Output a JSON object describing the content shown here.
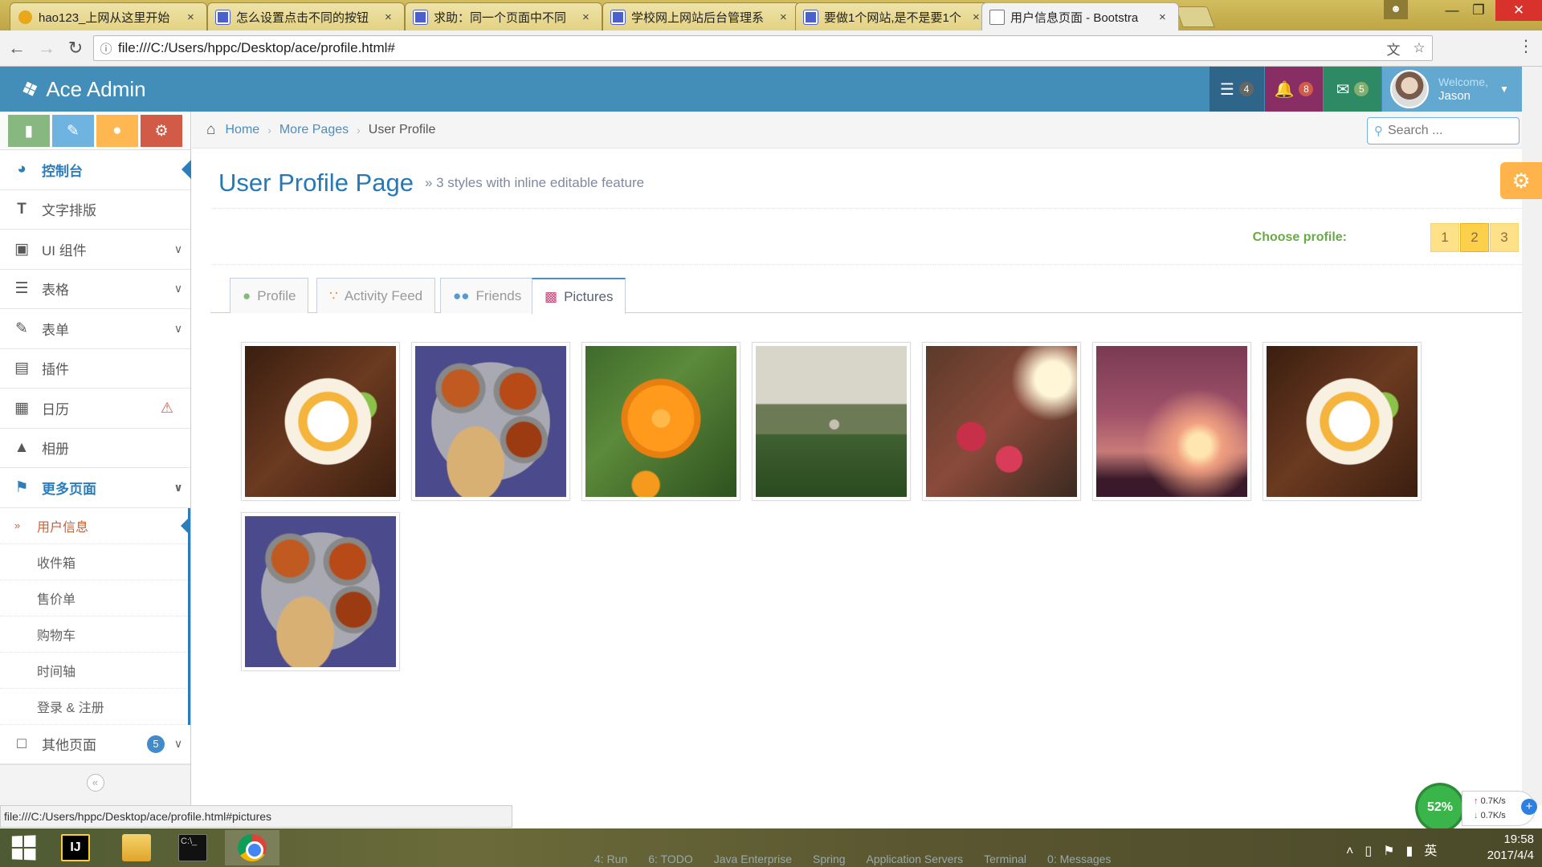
{
  "browser": {
    "tabs": [
      {
        "title": "hao123_上网从这里开始",
        "icon": "hao123-icon",
        "active": false
      },
      {
        "title": "怎么设置点击不同的按钮",
        "icon": "paw-icon",
        "active": false
      },
      {
        "title": "求助：同一个页面中不同",
        "icon": "paw-icon",
        "active": false
      },
      {
        "title": "学校网上网站后台管理系",
        "icon": "paw-icon",
        "active": false
      },
      {
        "title": "要做1个网站,是不是要1个",
        "icon": "paw-icon",
        "active": false
      },
      {
        "title": "用户信息页面 - Bootstra",
        "icon": "page-icon",
        "active": true
      }
    ],
    "tab_close": "×",
    "url": "file:///C:/Users/hppc/Desktop/ace/profile.html#",
    "status_url": "file:///C:/Users/hppc/Desktop/ace/profile.html#pictures"
  },
  "navbar": {
    "brand": "Ace Admin",
    "tasks_count": "4",
    "notifications_count": "8",
    "messages_count": "5",
    "welcome": "Welcome,",
    "username": "Jason"
  },
  "sidebar": {
    "items": [
      {
        "label": "控制台",
        "icon": "tachometer-icon"
      },
      {
        "label": "文字排版",
        "icon": "text-icon"
      },
      {
        "label": "UI 组件",
        "icon": "desktop-icon"
      },
      {
        "label": "表格",
        "icon": "list-icon"
      },
      {
        "label": "表单",
        "icon": "edit-icon"
      },
      {
        "label": "插件",
        "icon": "list-alt-icon"
      },
      {
        "label": "日历",
        "icon": "calendar-icon"
      },
      {
        "label": "相册",
        "icon": "picture-icon"
      },
      {
        "label": "更多页面",
        "icon": "tag-icon"
      },
      {
        "label": "其他页面",
        "icon": "file-icon"
      }
    ],
    "sub_items": [
      "用户信息",
      "收件箱",
      "售价单",
      "购物车",
      "时间轴",
      "登录 & 注册"
    ],
    "other_pages_badge": "5"
  },
  "breadcrumb": {
    "home": "Home",
    "more": "More Pages",
    "current": "User Profile"
  },
  "search": {
    "placeholder": "Search ..."
  },
  "page": {
    "title": "User Profile Page",
    "subtitle": "» 3 styles with inline editable feature",
    "choose_label": "Choose profile:",
    "profiles": [
      "1",
      "2",
      "3"
    ],
    "selected_profile": "2"
  },
  "tabs": {
    "profile": "Profile",
    "feed": "Activity Feed",
    "friends": "Friends",
    "pictures": "Pictures"
  },
  "pictures": [
    "breakfast-plate",
    "indian-thali",
    "orange-flower",
    "garden-fountain",
    "red-flowers-sunlight",
    "sunset-silhouette",
    "breakfast-plate",
    "indian-thali"
  ],
  "netmon": {
    "percent": "52%",
    "up": "0.7K/s",
    "down": "0.7K/s"
  },
  "taskbar": {
    "ide_tabs": [
      "4: Run",
      "6: TODO",
      "Java Enterprise",
      "Spring",
      "Application Servers",
      "Terminal",
      "0: Messages"
    ],
    "time": "19:58",
    "date": "2017/4/4",
    "ime": "英"
  }
}
